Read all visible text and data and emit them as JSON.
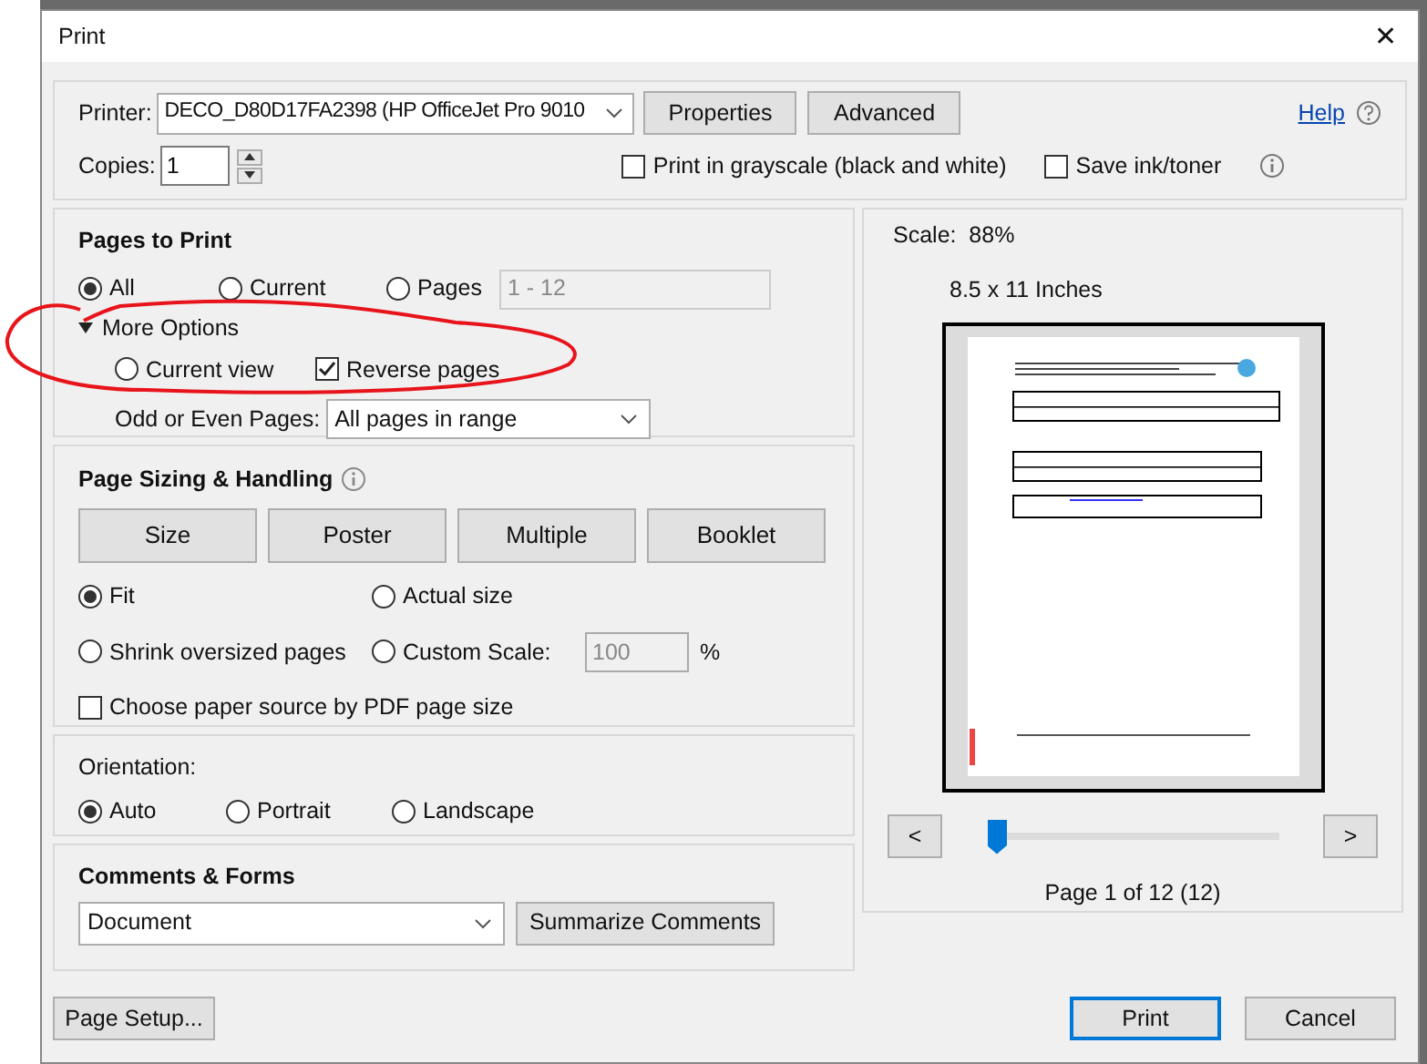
{
  "window": {
    "title": "Print",
    "close": "✕"
  },
  "printer": {
    "label": "Printer:",
    "value": "DECO_D80D17FA2398 (HP OfficeJet Pro 9010",
    "buttons": [
      "Properties",
      "Advanced"
    ],
    "help": "Help"
  },
  "copies": {
    "label": "Copies:",
    "value": "1"
  },
  "options": [
    {
      "label": "Print in grayscale (black and white)",
      "checked": false
    },
    {
      "label": "Save ink/toner",
      "checked": false
    }
  ],
  "pages_to_print": {
    "title": "Pages to Print",
    "radios": [
      {
        "label": "All",
        "selected": true
      },
      {
        "label": "Current",
        "selected": false
      },
      {
        "label": "Pages",
        "selected": false
      }
    ],
    "range": "1 - 12",
    "more_options": {
      "label": "More Options",
      "expanded": true,
      "current_view": {
        "label": "Current view",
        "selected": false
      },
      "reverse_pages": {
        "label": "Reverse pages",
        "checked": true
      }
    },
    "odd_even": {
      "label": "Odd or Even Pages:",
      "value": "All pages in range"
    }
  },
  "page_sizing": {
    "title": "Page Sizing & Handling",
    "buttons": [
      "Size",
      "Poster",
      "Multiple",
      "Booklet"
    ],
    "radios": [
      {
        "label": "Fit",
        "selected": true
      },
      {
        "label": "Actual size",
        "selected": false
      },
      {
        "label": "Shrink oversized pages",
        "selected": false
      },
      {
        "label": "Custom Scale:",
        "selected": false
      }
    ],
    "scale_value": "100",
    "scale_unit": "%",
    "paper_source": {
      "label": "Choose paper source by PDF page size",
      "checked": false
    }
  },
  "orientation": {
    "title": "Orientation:",
    "radios": [
      {
        "label": "Auto",
        "selected": true
      },
      {
        "label": "Portrait",
        "selected": false
      },
      {
        "label": "Landscape",
        "selected": false
      }
    ]
  },
  "comments_forms": {
    "title": "Comments & Forms",
    "value": "Document",
    "button": "Summarize Comments"
  },
  "preview": {
    "scale": "Scale:  88%",
    "size": "8.5 x 11 Inches",
    "prev": "<",
    "next": ">",
    "slider": {
      "level": 0
    },
    "page": "Page 1 of 12 (12)"
  },
  "footer": {
    "page_setup": "Page Setup...",
    "print": "Print",
    "cancel": "Cancel"
  }
}
